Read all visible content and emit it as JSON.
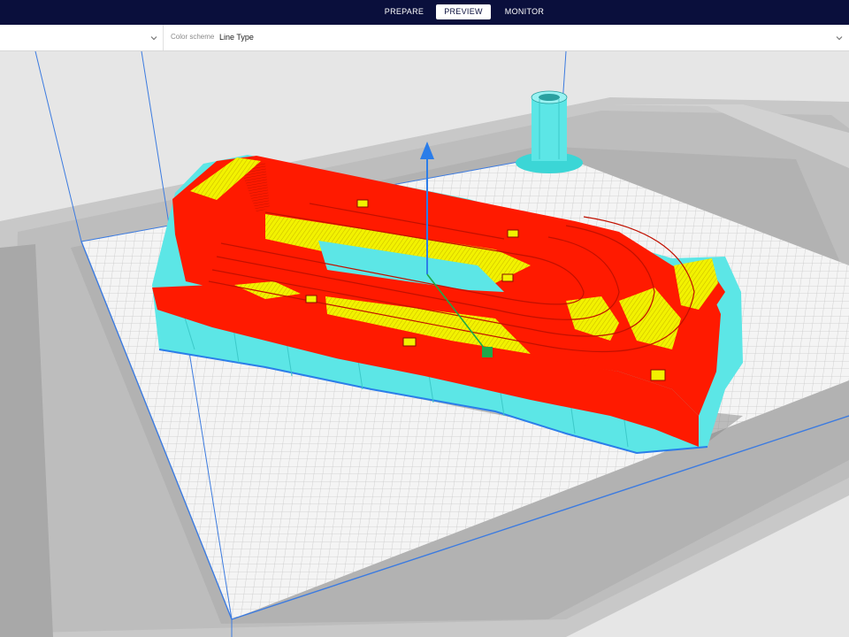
{
  "stages": {
    "prepare": "PREPARE",
    "preview": "PREVIEW",
    "monitor": "MONITOR"
  },
  "toolbar": {
    "color_scheme_label": "Color scheme",
    "color_scheme_value": "Line Type"
  },
  "colors": {
    "header_bg": "#0a0f3c",
    "wall_outer": "#ff1a00",
    "infill": "#f2f200",
    "support": "#5ce6e6",
    "build_volume": "#3c7be0",
    "axis_arrow": "#2b7de9",
    "origin_marker": "#1fa84a"
  },
  "icons": [
    "chevron-down-icon",
    "up-arrow-icon",
    "origin-handle-icon"
  ]
}
